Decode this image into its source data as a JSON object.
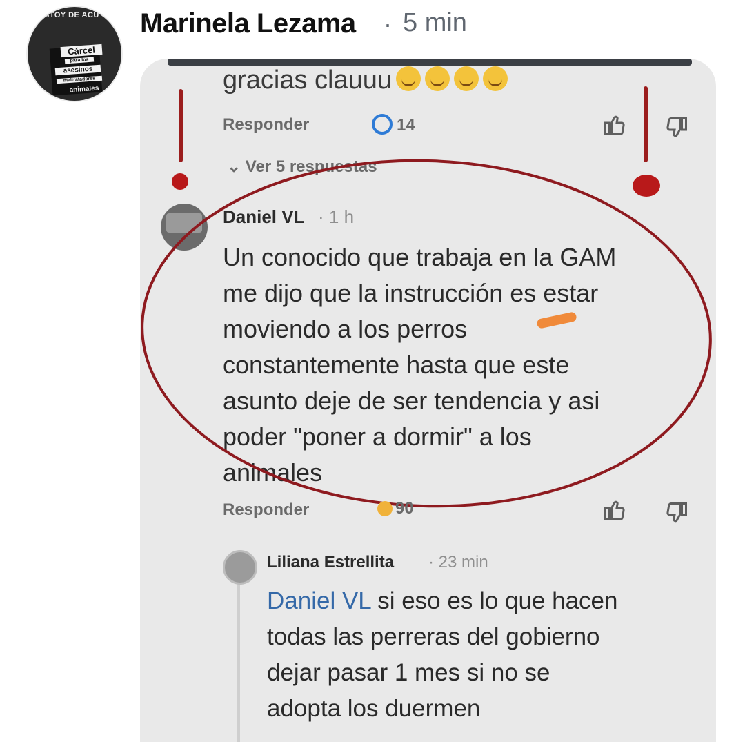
{
  "post": {
    "author": "Marinela Lezama",
    "separator": "·",
    "time": "5 min",
    "avatar_text": {
      "top": "STOY DE ACU",
      "l1": "Cárcel",
      "l2": "para los",
      "l3": "asesinos",
      "l4": "maltratadores",
      "l5": "animales"
    }
  },
  "screenshot": {
    "top_reply": {
      "text": "gracias clauuu",
      "emoji_count": 4,
      "reply_label": "Responder",
      "reaction_count": "14",
      "view_replies": "Ver 5 respuestas"
    },
    "comment": {
      "author": "Daniel VL",
      "time": "· 1 h",
      "lines": [
        "Un conocido que trabaja en la GAM",
        "me dijo que la instrucción es estar",
        "moviendo a los perros",
        "constantemente hasta que este",
        "asunto deje de ser tendencia y asi",
        "poder \"poner a dormir\" a los",
        "animales"
      ],
      "reply_label": "Responder",
      "reaction_count": "90"
    },
    "reply": {
      "author": "Liliana Estrellita",
      "time": "· 23 min",
      "mention": "Daniel VL",
      "first_line_rest": " si eso es lo que hacen",
      "lines": [
        "todas las perreras del gobierno",
        "dejar pasar 1 mes si no se",
        "adopta los duermen"
      ]
    }
  },
  "colors": {
    "annotation_red": "#9b1d1d",
    "annotation_orange": "#f08a3a",
    "card_bg": "#e9e9e9",
    "reaction_blue": "#2e7bd6",
    "mention_blue": "#3569a8"
  },
  "icons": [
    "thumbs-up-icon",
    "thumbs-down-icon",
    "chevron-down-icon",
    "reaction-icon"
  ]
}
